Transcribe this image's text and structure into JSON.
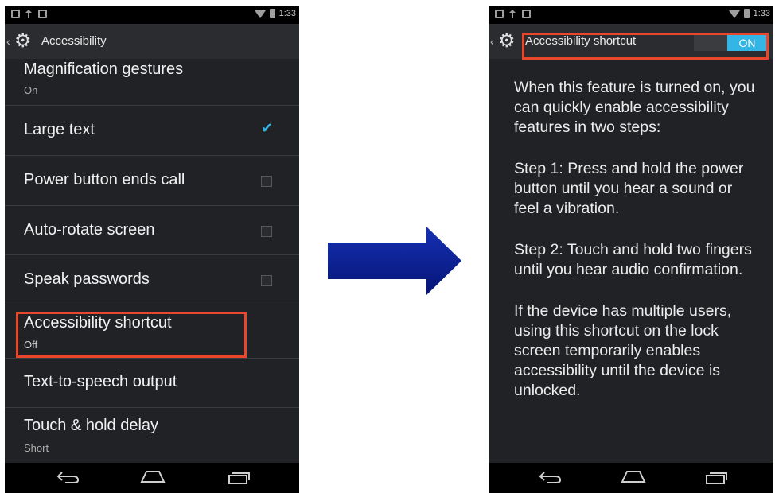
{
  "left_screen": {
    "status_bar": {
      "time": "1:33"
    },
    "action_bar": {
      "title": "Accessibility"
    },
    "items": [
      {
        "title": "Magnification gestures",
        "summary": "On"
      },
      {
        "title": "Large text",
        "checked": true
      },
      {
        "title": "Power button ends call",
        "checked": false
      },
      {
        "title": "Auto-rotate screen",
        "checked": false
      },
      {
        "title": "Speak passwords",
        "checked": false
      },
      {
        "title": "Accessibility shortcut",
        "summary": "Off",
        "highlighted": true
      },
      {
        "title": "Text-to-speech output"
      },
      {
        "title": "Touch & hold delay",
        "summary": "Short"
      }
    ]
  },
  "right_screen": {
    "status_bar": {
      "time": "1:33"
    },
    "action_bar": {
      "title": "Accessibility shortcut",
      "toggle_label": "ON",
      "highlighted": true
    },
    "paragraphs": [
      "When this feature is turned on, you can quickly enable accessibility features in two steps:",
      "Step 1: Press and hold the power button until you hear a sound or feel a vibration.",
      "Step 2: Touch and hold two fingers until you hear audio confirmation.",
      "If the device has multiple users, using this shortcut on the lock screen temporarily enables accessibility until the device is unlocked."
    ]
  },
  "colors": {
    "highlight": "#e8472b",
    "arrow": "#0a1f8f",
    "accent": "#33b5e5",
    "screen_bg": "#202225"
  },
  "icons": {
    "action_bar": "settings-gear-icon",
    "nav": [
      "back-icon",
      "home-icon",
      "recent-apps-icon"
    ]
  }
}
